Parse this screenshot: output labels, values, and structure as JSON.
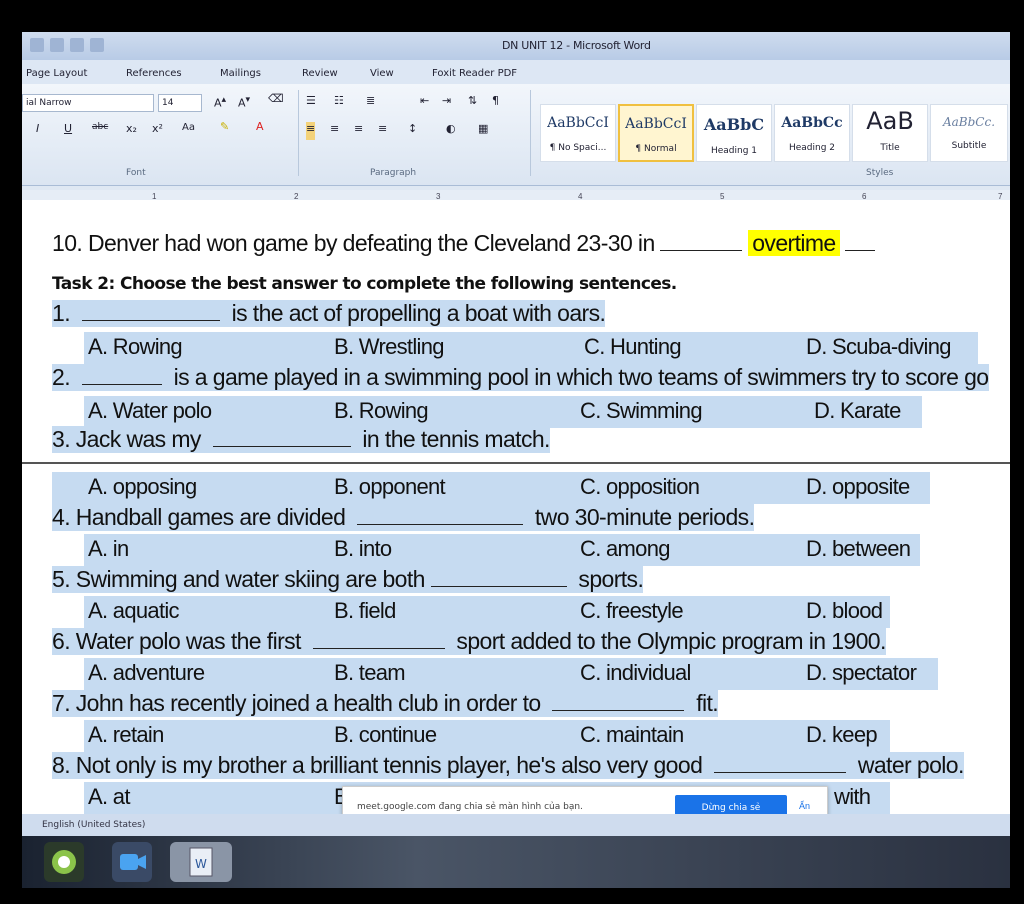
{
  "window": {
    "title": "DN UNIT 12 - Microsoft Word"
  },
  "tabs": [
    "Page Layout",
    "References",
    "Mailings",
    "Review",
    "View",
    "Foxit Reader PDF"
  ],
  "ribbon": {
    "font_name": "ial Narrow",
    "font_size": "14",
    "font_group_label": "Font",
    "paragraph_group_label": "Paragraph",
    "styles_group_label": "Styles",
    "styles": [
      {
        "sample": "AaBbCcI",
        "name": "¶ No Spaci..."
      },
      {
        "sample": "AaBbCcI",
        "name": "¶ Normal"
      },
      {
        "sample": "AaBbC",
        "name": "Heading 1"
      },
      {
        "sample": "AaBbCc",
        "name": "Heading 2"
      },
      {
        "sample": "AaB",
        "name": "Title"
      },
      {
        "sample": "AaBbCc.",
        "name": "Subtitle"
      }
    ]
  },
  "ruler": [
    "1",
    "2",
    "3",
    "4",
    "5",
    "6",
    "7"
  ],
  "document": {
    "line10": {
      "text": "10. Denver had won game by defeating the Cleveland 23-30 in",
      "answer": "overtime"
    },
    "task2": "Task 2: Choose the best answer to complete the following sentences.",
    "questions": [
      {
        "pre": "1.",
        "post": "is the act of propelling a boat with oars.",
        "options": [
          "A. Rowing",
          "B. Wrestling",
          "C. Hunting",
          "D. Scuba-diving"
        ]
      },
      {
        "pre": "2.",
        "post": "is a game played in a swimming pool in which two teams of swimmers try to score go",
        "options": [
          "A. Water polo",
          "B. Rowing",
          "C. Swimming",
          "D. Karate"
        ]
      },
      {
        "pre": "3. Jack was my",
        "post": "in the tennis match.",
        "options": [
          "A. opposing",
          "B. opponent",
          "C. opposition",
          "D. opposite"
        ]
      },
      {
        "pre": "4. Handball games are divided",
        "post": "two 30-minute periods.",
        "options": [
          "A. in",
          "B. into",
          "C. among",
          "D. between"
        ]
      },
      {
        "pre": "5. Swimming and water skiing are both",
        "post": "sports.",
        "options": [
          "A. aquatic",
          "B. field",
          "C. freestyle",
          "D. blood"
        ]
      },
      {
        "pre": "6. Water polo was the first",
        "post": "sport added to the Olympic program in 1900.",
        "options": [
          "A. adventure",
          "B. team",
          "C. individual",
          "D. spectator"
        ]
      },
      {
        "pre": "7. John has recently joined a health club in order to",
        "post": "fit.",
        "options": [
          "A. retain",
          "B. continue",
          "C. maintain",
          "D. keep"
        ]
      },
      {
        "pre": "8. Not only is my brother a brilliant tennis player, he's also very good",
        "post": "water polo.",
        "options": [
          "A. at",
          "B",
          "",
          "with"
        ]
      }
    ]
  },
  "meet_banner": {
    "message": "meet.google.com đang chia sẻ màn hình của bạn.",
    "stop_label": "Dừng chia sẻ",
    "hide_label": "Ẩn"
  },
  "status_bar": {
    "language": "English (United States)"
  },
  "colors": {
    "highlight_selection": "#c6dbf1",
    "highlight_yellow": "#ffff00",
    "meet_blue": "#1a73e8"
  }
}
